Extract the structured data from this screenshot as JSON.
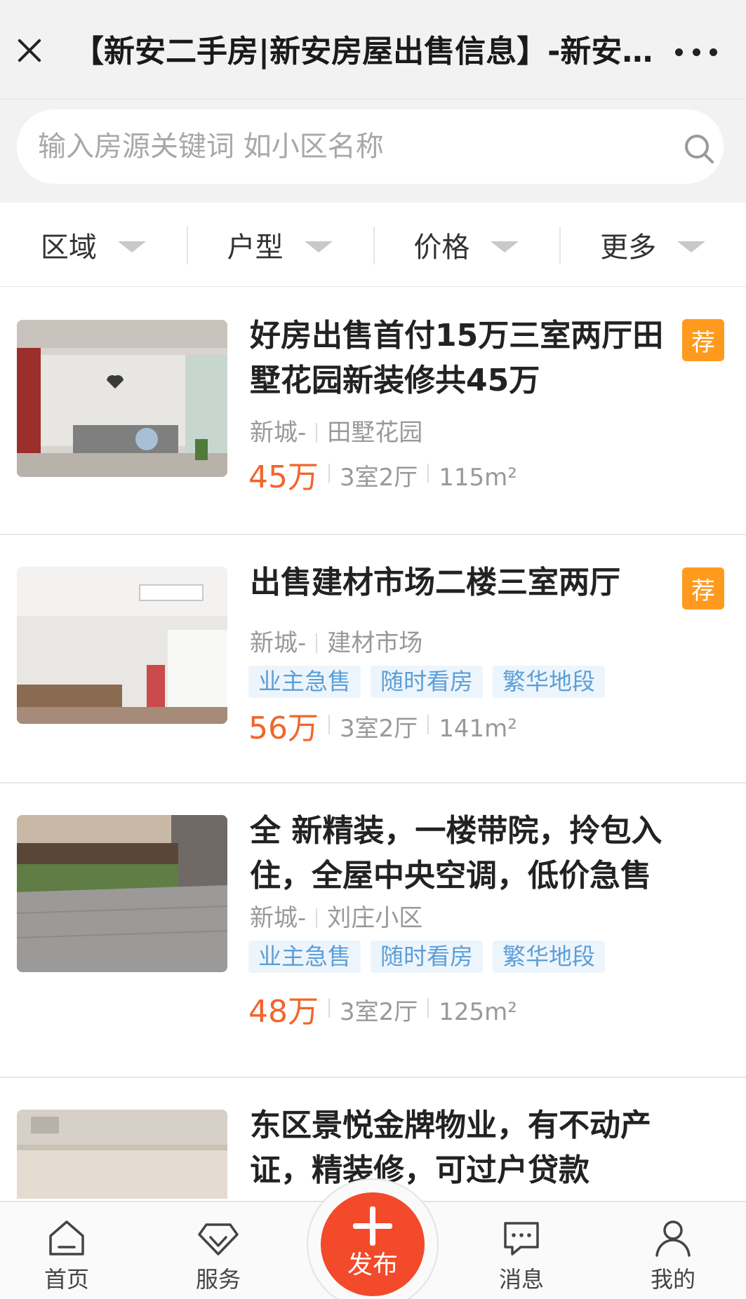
{
  "header": {
    "title": "【新安二手房|新安房屋出售信息】-新安二手房网"
  },
  "search": {
    "placeholder": "输入房源关键词 如小区名称"
  },
  "filters": [
    "区域",
    "户型",
    "价格",
    "更多"
  ],
  "listings": [
    {
      "title": "好房出售首付15万三室两厅田墅花园新装修共45万",
      "badge": "荐",
      "district": "新城-",
      "community": "田墅花园",
      "tags": [],
      "price": "45万",
      "layout": "3室2厅",
      "area": "115m²"
    },
    {
      "title": "出售建材市场二楼三室两厅",
      "badge": "荐",
      "district": "新城-",
      "community": "建材市场",
      "tags": [
        "业主急售",
        "随时看房",
        "繁华地段"
      ],
      "price": "56万",
      "layout": "3室2厅",
      "area": "141m²"
    },
    {
      "title": "全 新精装，一楼带院，拎包入住，全屋中央空调，低价急售",
      "badge": "",
      "district": "新城-",
      "community": "刘庄小区",
      "tags": [
        "业主急售",
        "随时看房",
        "繁华地段"
      ],
      "price": "48万",
      "layout": "3室2厅",
      "area": "125m²"
    },
    {
      "title": "东区景悦金牌物业，有不动产证，精装修，可过户贷款",
      "badge": "",
      "district": "",
      "community": "",
      "tags": [],
      "price": "",
      "layout": "",
      "area": ""
    }
  ],
  "nav": {
    "home": "首页",
    "service": "服务",
    "publish": "发布",
    "messages": "消息",
    "mine": "我的"
  },
  "colors": {
    "price": "#f2652b",
    "badge": "#ff9a1e",
    "tag_text": "#5d9fd6",
    "tag_bg": "#edf5fc",
    "publish": "#f24a2a"
  }
}
